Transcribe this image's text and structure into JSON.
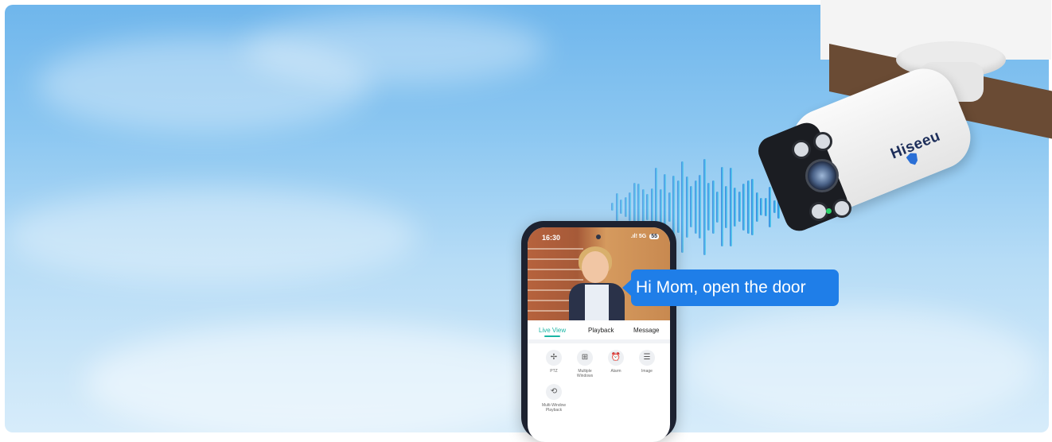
{
  "speech_bubble": {
    "text": "Hi Mom, open the door"
  },
  "camera": {
    "brand": "Hiseeu"
  },
  "phone": {
    "status": {
      "time": "16:30",
      "signal": ".ıl! 5G",
      "battery": "55"
    },
    "tabs": [
      {
        "label": "Live View",
        "active": true
      },
      {
        "label": "Playback",
        "active": false
      },
      {
        "label": "Message",
        "active": false
      }
    ],
    "functions": [
      {
        "label": "PTZ",
        "icon": "ptz-icon",
        "glyph": "✢"
      },
      {
        "label": "Multiple\nWindows",
        "icon": "grid-icon",
        "glyph": "⊞"
      },
      {
        "label": "Alarm",
        "icon": "alarm-icon",
        "glyph": "⏰"
      },
      {
        "label": "Image",
        "icon": "sliders-icon",
        "glyph": "☰"
      },
      {
        "label": "Multi-Window\nPlayback",
        "icon": "playback-icon",
        "glyph": "⟲"
      }
    ]
  },
  "colors": {
    "accent": "#1bb5a4",
    "bubble": "#1f7ee8",
    "wave_blue": "#1f6fd8",
    "wave_cyan": "#45d6ef"
  }
}
